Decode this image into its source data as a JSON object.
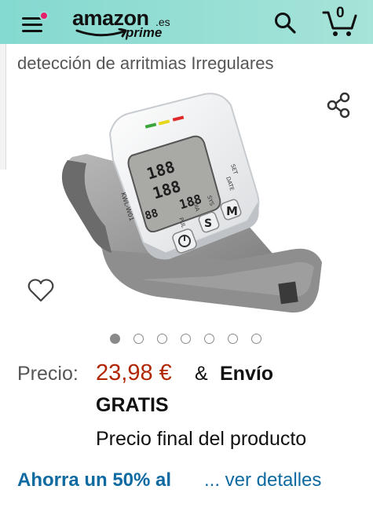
{
  "header": {
    "logo_main": "amazon",
    "logo_suffix": ".es",
    "logo_sub": "prime",
    "cart_count": "0",
    "colors": {
      "background": "#9fe0d6",
      "notification_dot": "#e4206b"
    },
    "icons": [
      "menu-icon",
      "search-icon",
      "cart-icon"
    ]
  },
  "product": {
    "title": "detección de arritmias Irregulares",
    "image_alt": "wrist-blood-pressure-monitor",
    "carousel": {
      "total": 7,
      "active": 1
    },
    "device_labels": {
      "model": "KWL-W01",
      "set": "SET",
      "date": "DATE",
      "sys": "SYS",
      "dia": "DIA",
      "pul": "PUL",
      "m_button": "M",
      "s_button": "S",
      "lcd_line1": "188",
      "lcd_line2": "188",
      "lcd_line3": "188",
      "lcd_time": "88"
    }
  },
  "pricing": {
    "label": "Precio:",
    "value": "23,98 €",
    "shipping_amp": "&",
    "shipping_line1": "Envío",
    "shipping_line2": "GRATIS",
    "final_price_note": "Precio final del producto",
    "savings_text": "Ahorra un 50% al",
    "savings_link": "... ver detalles",
    "colors": {
      "price": "#b12704",
      "link": "#0e6aa0"
    }
  }
}
